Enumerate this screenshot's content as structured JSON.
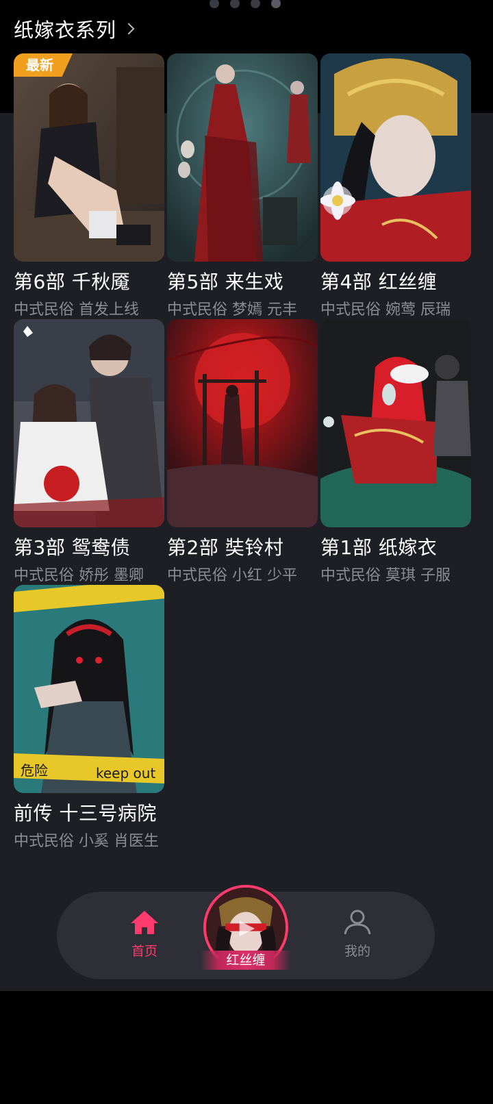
{
  "header": {
    "title": "纸嫁衣系列"
  },
  "pager": {
    "count": 4,
    "active_index": 3
  },
  "cards": [
    {
      "title": "第6部 千秋魇",
      "subtitle": "中式民俗 首发上线",
      "badge": "最新"
    },
    {
      "title": "第5部 来生戏",
      "subtitle": "中式民俗 梦嫣 元丰"
    },
    {
      "title": "第4部 红丝缠",
      "subtitle": "中式民俗 婉莺 辰瑞"
    },
    {
      "title": "第3部 鸳鸯债",
      "subtitle": "中式民俗 娇彤 墨卿"
    },
    {
      "title": "第2部 奘铃村",
      "subtitle": "中式民俗 小红 少平"
    },
    {
      "title": "第1部 纸嫁衣",
      "subtitle": "中式民俗 莫琪 子服"
    },
    {
      "title": "前传 十三号病院",
      "subtitle": "中式民俗 小奚 肖医生",
      "cover_text": [
        "危险",
        "keep out"
      ]
    }
  ],
  "tabbar": {
    "home_label": "首页",
    "center_label": "红丝缠",
    "mine_label": "我的"
  },
  "colors": {
    "accent": "#ff3b6e",
    "badge": "#f0a01e",
    "panel": "#1e1e25"
  }
}
